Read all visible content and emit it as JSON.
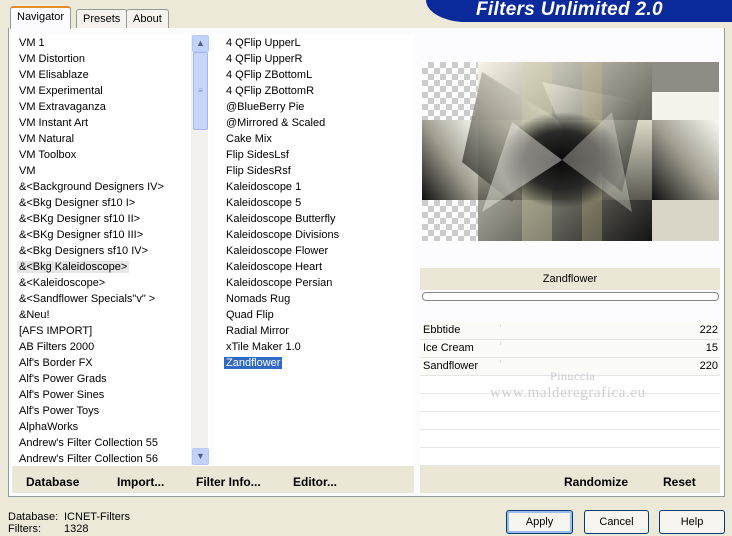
{
  "app_title": "Filters Unlimited 2.0",
  "tabs": [
    {
      "label": "Navigator"
    },
    {
      "label": "Presets"
    },
    {
      "label": "About"
    }
  ],
  "categories": [
    "VM 1",
    "VM Distortion",
    "VM Elisablaze",
    "VM Experimental",
    "VM Extravaganza",
    "VM Instant Art",
    "VM Natural",
    "VM Toolbox",
    "VM",
    "&<Background Designers IV>",
    "&<Bkg Designer sf10 I>",
    "&<BKg Designer sf10 II>",
    "&<BKg Designer sf10 III>",
    "&<Bkg Designers sf10 IV>",
    "&<Bkg Kaleidoscope>",
    "&<Kaleidoscope>",
    "&<Sandflower Specials\"v\" >",
    "&Neu!",
    "[AFS IMPORT]",
    "AB Filters 2000",
    "Alf's Border FX",
    "Alf's Power Grads",
    "Alf's Power Sines",
    "Alf's Power Toys",
    "AlphaWorks",
    "Andrew's Filter Collection 55",
    "Andrew's Filter Collection 56"
  ],
  "selected_category_index": 14,
  "filters": [
    "4 QFlip UpperL",
    "4 QFlip UpperR",
    "4 QFlip ZBottomL",
    "4 QFlip ZBottomR",
    "@BlueBerry Pie",
    "@Mirrored & Scaled",
    "Cake Mix",
    "Flip SidesLsf",
    "Flip SidesRsf",
    "Kaleidoscope 1",
    "Kaleidoscope 5",
    "Kaleidoscope Butterfly",
    "Kaleidoscope Divisions",
    "Kaleidoscope Flower",
    "Kaleidoscope Heart",
    "Kaleidoscope Persian",
    "Nomads Rug",
    "Quad Flip",
    "Radial Mirror",
    "xTile Maker 1.0",
    "Zandflower"
  ],
  "selected_filter_index": 20,
  "preview_filter_name": "Zandflower",
  "parameters": [
    {
      "label": "Ebbtide",
      "value": "222"
    },
    {
      "label": "Ice Cream",
      "value": "15"
    },
    {
      "label": "Sandflower",
      "value": "220"
    }
  ],
  "watermark": {
    "line1": "Pinuccia",
    "line2": "www.malderegrafica.eu"
  },
  "actions": {
    "database": "Database",
    "import": "Import...",
    "filter_info": "Filter Info...",
    "editor": "Editor...",
    "randomize": "Randomize",
    "reset": "Reset"
  },
  "status": {
    "database_label": "Database:",
    "database_value": "ICNET-Filters",
    "filters_label": "Filters:",
    "filters_value": "1328"
  },
  "buttons": {
    "apply": "Apply",
    "cancel": "Cancel",
    "help": "Help"
  },
  "colors": {
    "banner": "#0a2a9c",
    "selection": "#316ac5",
    "tab_accent": "#e68b2c"
  }
}
